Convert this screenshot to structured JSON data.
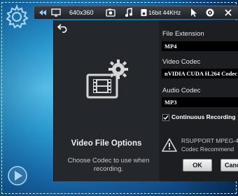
{
  "toolbar": {
    "resolution": "640x360",
    "audio_format": "16bit 44KHz",
    "icons": [
      "rewind-icon",
      "monitor-icon",
      "camera-icon",
      "music-icon",
      "speaker-icon",
      "cursor-icon",
      "target-icon",
      "close-icon"
    ]
  },
  "dialog": {
    "title": "Video File Options",
    "description": "Choose Codec to use when recording.",
    "file_extension_label": "File Extension",
    "file_extension_value": "MP4",
    "video_codec_label": "Video Codec",
    "video_codec_value": "nVIDIA CUDA H.264 Codec",
    "audio_codec_label": "Audio Codec",
    "audio_codec_value": "MP3",
    "continuous_recording_label": "Continuous Recording",
    "continuous_recording_checked": true,
    "warning_line1": "RSUPPORT MPEG-4",
    "warning_line2": "Codec Recommend",
    "ok_label": "OK",
    "cancel_label": "Cancel"
  },
  "colors": {
    "background_accent": "#2c9fd6",
    "dialog_bg": "#24272b",
    "field_bg": "#000000"
  }
}
